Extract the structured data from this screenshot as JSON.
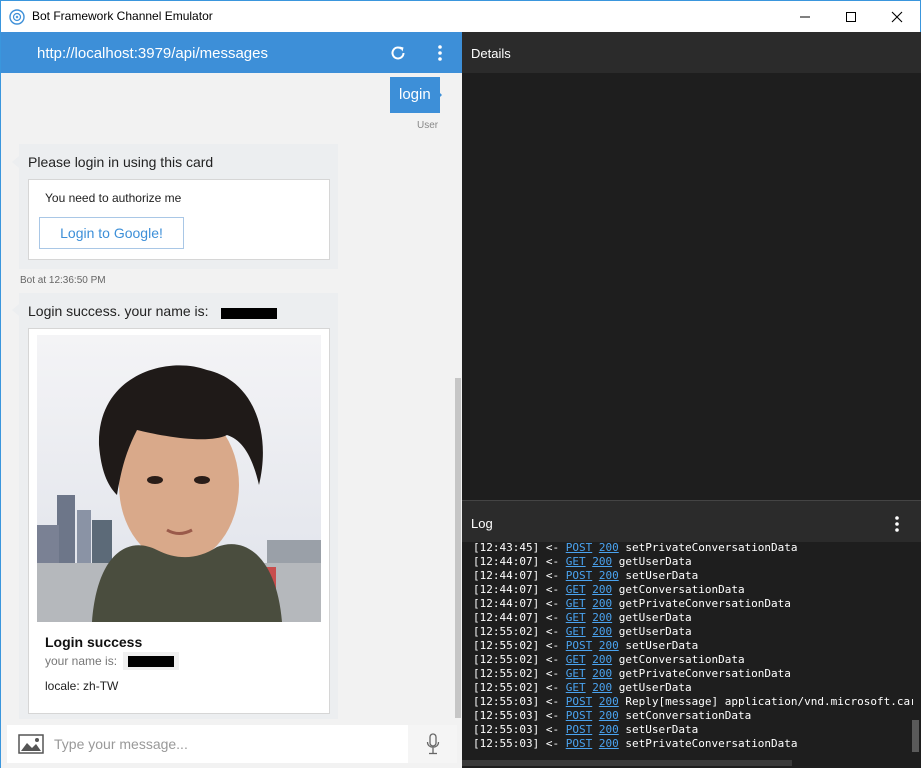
{
  "window": {
    "title": "Bot Framework Channel Emulator"
  },
  "chat": {
    "address": "http://localhost:3979/api/messages",
    "messages": {
      "user_login": {
        "text": "login",
        "sender": "User"
      },
      "login_card": {
        "text": "Please login in using this card",
        "card_text": "You need to authorize me",
        "button_label": "Login to Google!",
        "timestamp": "Bot at 12:36:50 PM"
      },
      "success": {
        "text": "Login success. your name is:",
        "card_title": "Login success",
        "card_subtitle": "your name is:",
        "card_locale": "locale: zh-TW"
      }
    },
    "input": {
      "placeholder": "Type your message..."
    }
  },
  "details": {
    "title": "Details"
  },
  "log": {
    "title": "Log",
    "entries": [
      {
        "time": "[12:43:45]",
        "dir": "<-",
        "method": "POST",
        "status": "200",
        "text": "setPrivateConversationData"
      },
      {
        "time": "[12:44:07]",
        "dir": "<-",
        "method": "GET",
        "status": "200",
        "text": "getUserData"
      },
      {
        "time": "[12:44:07]",
        "dir": "<-",
        "method": "POST",
        "status": "200",
        "text": "setUserData"
      },
      {
        "time": "[12:44:07]",
        "dir": "<-",
        "method": "GET",
        "status": "200",
        "text": "getConversationData"
      },
      {
        "time": "[12:44:07]",
        "dir": "<-",
        "method": "GET",
        "status": "200",
        "text": "getPrivateConversationData"
      },
      {
        "time": "[12:44:07]",
        "dir": "<-",
        "method": "GET",
        "status": "200",
        "text": "getUserData"
      },
      {
        "time": "[12:55:02]",
        "dir": "<-",
        "method": "GET",
        "status": "200",
        "text": "getUserData"
      },
      {
        "time": "[12:55:02]",
        "dir": "<-",
        "method": "POST",
        "status": "200",
        "text": "setUserData"
      },
      {
        "time": "[12:55:02]",
        "dir": "<-",
        "method": "GET",
        "status": "200",
        "text": "getConversationData"
      },
      {
        "time": "[12:55:02]",
        "dir": "<-",
        "method": "GET",
        "status": "200",
        "text": "getPrivateConversationData"
      },
      {
        "time": "[12:55:02]",
        "dir": "<-",
        "method": "GET",
        "status": "200",
        "text": "getUserData"
      },
      {
        "time": "[12:55:03]",
        "dir": "<-",
        "method": "POST",
        "status": "200",
        "text": "Reply[message] application/vnd.microsoft.car"
      },
      {
        "time": "[12:55:03]",
        "dir": "<-",
        "method": "POST",
        "status": "200",
        "text": "setConversationData"
      },
      {
        "time": "[12:55:03]",
        "dir": "<-",
        "method": "POST",
        "status": "200",
        "text": "setUserData"
      },
      {
        "time": "[12:55:03]",
        "dir": "<-",
        "method": "POST",
        "status": "200",
        "text": "setPrivateConversationData"
      }
    ]
  },
  "colors": {
    "accent": "#3d8fd8",
    "dark_bg": "#1e1e1e",
    "link": "#4aa3f0"
  },
  "icons": [
    "app-icon",
    "minimize-icon",
    "maximize-icon",
    "close-icon",
    "refresh-icon",
    "more-vertical-icon",
    "image-icon",
    "microphone-icon"
  ]
}
